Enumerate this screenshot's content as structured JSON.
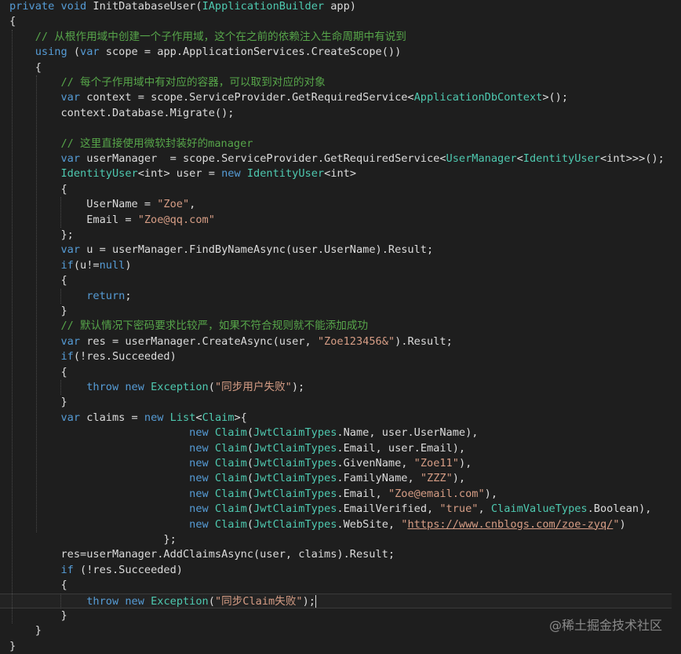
{
  "code_lines": [
    "private void InitDatabaseUser(IApplicationBuilder app)",
    "{",
    "    // 从根作用域中创建一个子作用域，这个在之前的依赖注入生命周期中有说到",
    "    using (var scope = app.ApplicationServices.CreateScope())",
    "    {",
    "        // 每个子作用域中有对应的容器，可以取到对应的对象",
    "        var context = scope.ServiceProvider.GetRequiredService<ApplicationDbContext>();",
    "        context.Database.Migrate();",
    "",
    "        // 这里直接使用微软封装好的manager",
    "        var userManager  = scope.ServiceProvider.GetRequiredService<UserManager<IdentityUser<int>>>();",
    "        IdentityUser<int> user = new IdentityUser<int>",
    "        {",
    "            UserName = \"Zoe\",",
    "            Email = \"Zoe@qq.com\"",
    "        };",
    "        var u = userManager.FindByNameAsync(user.UserName).Result;",
    "        if(u!=null)",
    "        {",
    "            return;",
    "        }",
    "        // 默认情况下密码要求比较严，如果不符合规则就不能添加成功",
    "        var res = userManager.CreateAsync(user, \"Zoe123456&\").Result;",
    "        if(!res.Succeeded)",
    "        {",
    "            throw new Exception(\"同步用户失败\");",
    "        }",
    "        var claims = new List<Claim>{",
    "                            new Claim(JwtClaimTypes.Name, user.UserName),",
    "                            new Claim(JwtClaimTypes.Email, user.Email),",
    "                            new Claim(JwtClaimTypes.GivenName, \"Zoe11\"),",
    "                            new Claim(JwtClaimTypes.FamilyName, \"ZZZ\"),",
    "                            new Claim(JwtClaimTypes.Email, \"Zoe@email.com\"),",
    "                            new Claim(JwtClaimTypes.EmailVerified, \"true\", ClaimValueTypes.Boolean),",
    "                            new Claim(JwtClaimTypes.WebSite, \"https://www.cnblogs.com/zoe-zyq/\")",
    "                        };",
    "        res=userManager.AddClaimsAsync(user, claims).Result;",
    "        if (!res.Succeeded)",
    "        {",
    "            throw new Exception(\"同步Claim失败\");",
    "        }",
    "    }",
    "}"
  ],
  "current_line": 39,
  "watermark": "@稀土掘金技术社区",
  "colors": {
    "background": "#1e1e1e",
    "keyword": "#569cd6",
    "type": "#4ec9b0",
    "string": "#d69d85",
    "comment": "#57a64a",
    "plain": "#dcdcdc"
  }
}
